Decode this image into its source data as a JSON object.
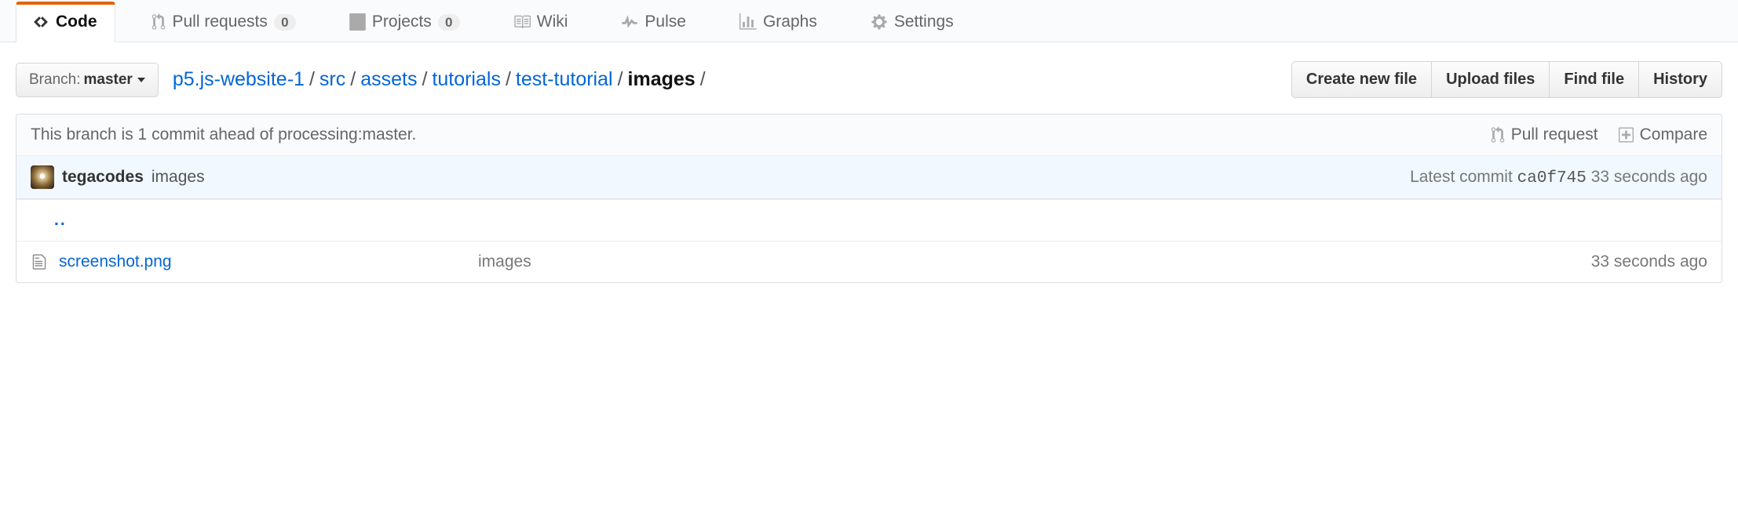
{
  "tabs": {
    "code": "Code",
    "pulls": "Pull requests",
    "pulls_count": "0",
    "projects": "Projects",
    "projects_count": "0",
    "wiki": "Wiki",
    "pulse": "Pulse",
    "graphs": "Graphs",
    "settings": "Settings"
  },
  "branch_selector": {
    "label": "Branch:",
    "value": "master"
  },
  "breadcrumb": {
    "root": "p5.js-website-1",
    "parts": [
      "src",
      "assets",
      "tutorials",
      "test-tutorial"
    ],
    "final": "images",
    "sep": "/"
  },
  "actions": {
    "create": "Create new file",
    "upload": "Upload files",
    "find": "Find file",
    "history": "History"
  },
  "branch_info": {
    "text": "This branch is 1 commit ahead of processing:master.",
    "pull_request": "Pull request",
    "compare": "Compare"
  },
  "latest_commit": {
    "author": "tegacodes",
    "message": "images",
    "prefix": "Latest commit",
    "sha": "ca0f745",
    "age": "33 seconds ago"
  },
  "rows": {
    "up": "..",
    "file": {
      "name": "screenshot.png",
      "message": "images",
      "age": "33 seconds ago"
    }
  }
}
